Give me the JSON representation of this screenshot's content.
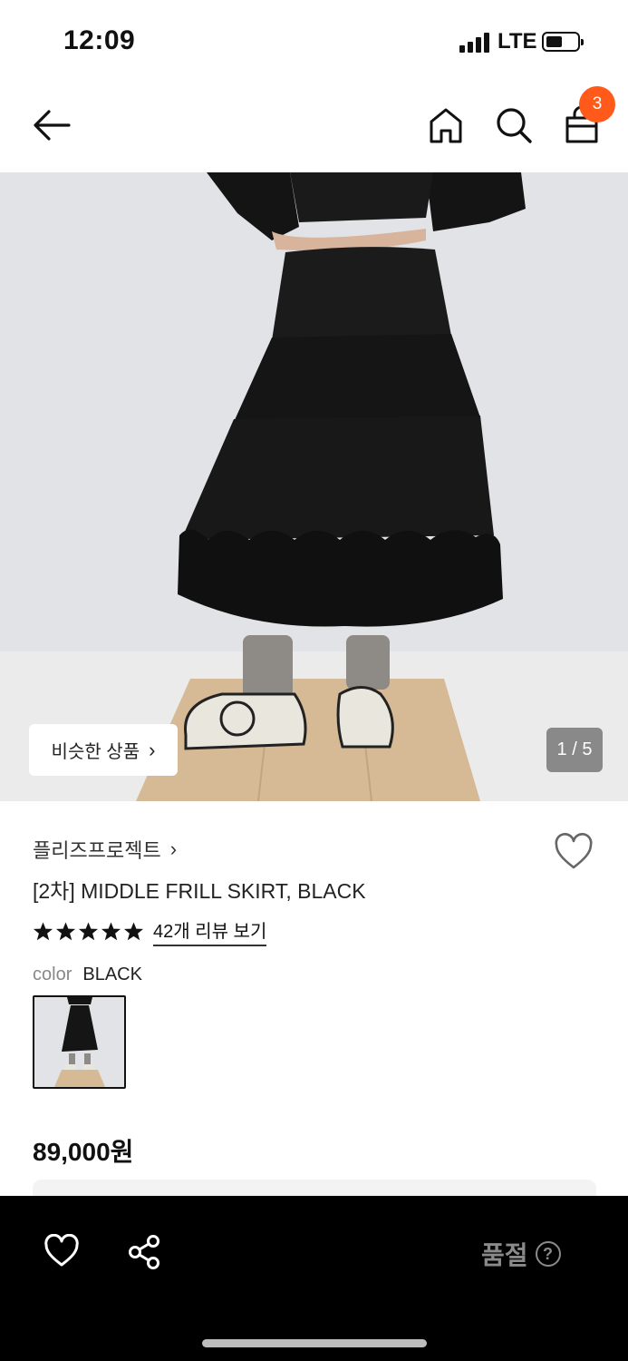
{
  "status": {
    "time": "12:09",
    "network": "LTE"
  },
  "header": {
    "cart_count": "3"
  },
  "gallery": {
    "similar_label": "비슷한 상품",
    "counter": "1 / 5"
  },
  "product": {
    "brand": "플리즈프로젝트",
    "title": "[2차] MIDDLE FRILL SKIRT, BLACK",
    "rating": 5,
    "review_link": "42개 리뷰 보기",
    "color_label": "color",
    "color_value": "BLACK",
    "price": "89,000원"
  },
  "footer": {
    "status_label": "품절",
    "help_symbol": "?"
  },
  "colors": {
    "badge": "#ff5a1a",
    "bar": "#000000",
    "disabled_text": "#8a8a8a"
  },
  "icons": [
    "back-arrow-icon",
    "home-icon",
    "search-icon",
    "shopping-bag-icon",
    "heart-icon",
    "star-icon",
    "share-icon",
    "help-icon"
  ]
}
